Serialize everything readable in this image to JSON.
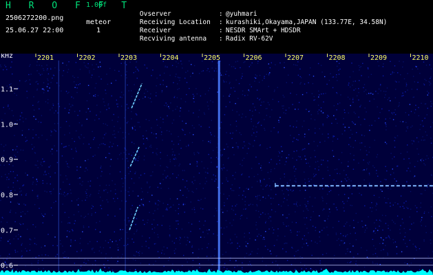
{
  "header": {
    "app_title": "H R O F F T",
    "version": "1.00f",
    "filename": "2506272200.png",
    "datetime": "25.06.27 22:00",
    "meteor_label": "meteor",
    "meteor_count": "1"
  },
  "info": [
    {
      "key": "Ovserver",
      "sep": ":",
      "value": "@yuhmari"
    },
    {
      "key": "Receiving Location",
      "sep": ":",
      "value": "kurashiki,Okayama,JAPAN (133.77E, 34.58N)"
    },
    {
      "key": "Receiver",
      "sep": ":",
      "value": "NESDR SMArt + HDSDR"
    },
    {
      "key": "Recviving antenna",
      "sep": ":",
      "value": "Radix RV-62V"
    }
  ],
  "colors": {
    "title": "#00e27a",
    "background_noise": "#00007a",
    "signal": "#6fd0ff",
    "tick_text": "#ffff66",
    "baseline": "#00ffff"
  },
  "chart_data": {
    "type": "heatmap",
    "x_unit_label": "",
    "x_ticks": [
      "2201",
      "2202",
      "2203",
      "2204",
      "2205",
      "2206",
      "2207",
      "2208",
      "2209",
      "2210"
    ],
    "y_label": "kHz",
    "y_ticks": [
      "1.1",
      "1.0",
      "0.9",
      "0.8",
      "0.7",
      "0.6"
    ],
    "y_range": [
      0.58,
      1.18
    ],
    "vertical_lines_minutes": [
      0.55,
      2.15,
      4.4
    ],
    "meteor_streaks": [
      {
        "x_start": 2.3,
        "x_end": 2.55,
        "y_start": 1.045,
        "y_end": 1.115
      },
      {
        "x_start": 2.27,
        "x_end": 2.48,
        "y_start": 0.88,
        "y_end": 0.935
      },
      {
        "x_start": 2.25,
        "x_end": 2.45,
        "y_start": 0.7,
        "y_end": 0.765
      }
    ],
    "carrier_trace": {
      "x_start": 5.75,
      "x_end": 9.8,
      "y": 0.825
    },
    "reference_lines_khz": [
      0.62,
      0.6
    ]
  }
}
